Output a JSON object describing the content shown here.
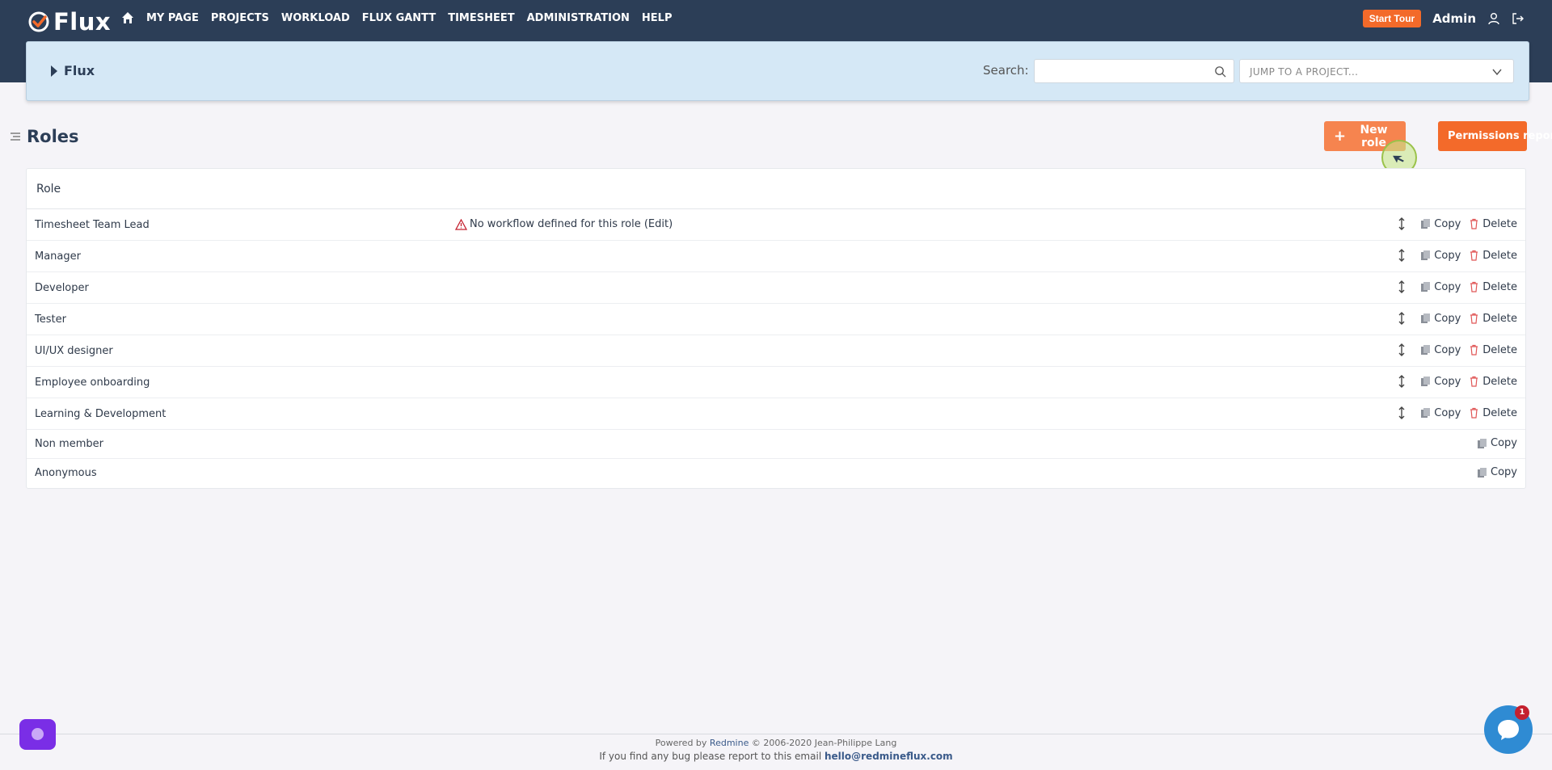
{
  "topbar": {
    "logo_text": "Flux",
    "nav": [
      "MY PAGE",
      "PROJECTS",
      "WORKLOAD",
      "FLUX GANTT",
      "TIMESHEET",
      "ADMINISTRATION",
      "HELP"
    ],
    "start_tour": "Start Tour",
    "user": "Admin"
  },
  "project": {
    "name": "Flux",
    "search_label": "Search:",
    "search_value": "",
    "jump_placeholder": "JUMP TO A PROJECT..."
  },
  "page": {
    "title": "Roles",
    "new_role": "New role",
    "permissions_report": "Permissions report"
  },
  "table": {
    "header": "Role",
    "copy_label": "Copy",
    "delete_label": "Delete",
    "rows": [
      {
        "name": "Timesheet Team Lead",
        "warning": "No workflow defined for this role (Edit)"
      },
      {
        "name": "Manager"
      },
      {
        "name": "Developer"
      },
      {
        "name": "Tester"
      },
      {
        "name": "UI/UX designer"
      },
      {
        "name": "Employee onboarding"
      },
      {
        "name": "Learning & Development"
      },
      {
        "name": "Non member"
      },
      {
        "name": "Anonymous"
      }
    ]
  },
  "footer": {
    "powered_prefix": "Powered by",
    "redmine": "Redmine",
    "copyright": "© 2006-2020 Jean-Philippe Lang",
    "bug_text": "If you find any bug please report to this email",
    "email": "hello@redmineflux.com"
  },
  "chat": {
    "badge": "1"
  },
  "colors": {
    "topbar": "#2c3e57",
    "accent": "#f36a2a",
    "panel": "#d5e8f6",
    "delete": "#e05656"
  }
}
